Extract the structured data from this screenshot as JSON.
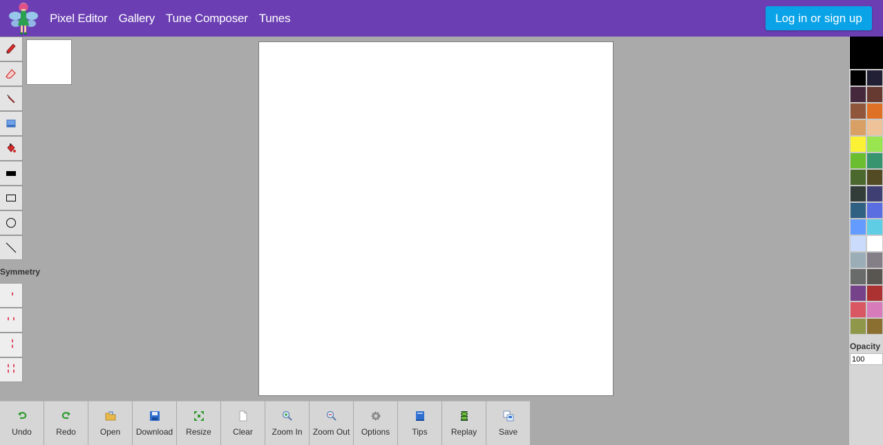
{
  "nav": {
    "links": [
      "Pixel Editor",
      "Gallery",
      "Tune Composer",
      "Tunes"
    ],
    "login_label": "Log in or sign up"
  },
  "tools": [
    "pencil-icon",
    "eraser-icon",
    "eyedropper-icon",
    "select-icon",
    "fill-bucket-icon",
    "filled-rectangle-icon",
    "rectangle-icon",
    "circle-icon",
    "line-icon"
  ],
  "symmetry": {
    "label": "Symmetry",
    "modes": [
      "symmetry-none",
      "symmetry-horizontal",
      "symmetry-vertical",
      "symmetry-both"
    ]
  },
  "toolbar": {
    "buttons": [
      "Undo",
      "Redo",
      "Open",
      "Download",
      "Resize",
      "Clear",
      "Zoom In",
      "Zoom Out",
      "Options",
      "Tips",
      "Replay",
      "Save"
    ]
  },
  "palette": {
    "current": "#000000",
    "colors": [
      "#000000",
      "#222034",
      "#45283c",
      "#663931",
      "#8f563b",
      "#df7126",
      "#d9a066",
      "#eec39a",
      "#fbf236",
      "#99e550",
      "#6abe30",
      "#37946e",
      "#4b692f",
      "#524b24",
      "#323c39",
      "#3f3f74",
      "#306082",
      "#5b6ee1",
      "#639bff",
      "#5fcde4",
      "#cbdbfc",
      "#ffffff",
      "#9badb7",
      "#847e87",
      "#696a6a",
      "#595652",
      "#76428a",
      "#ac3232",
      "#d95763",
      "#d77bba",
      "#8f974a",
      "#8a6f30"
    ]
  },
  "opacity": {
    "label": "Opacity",
    "value": "100"
  }
}
